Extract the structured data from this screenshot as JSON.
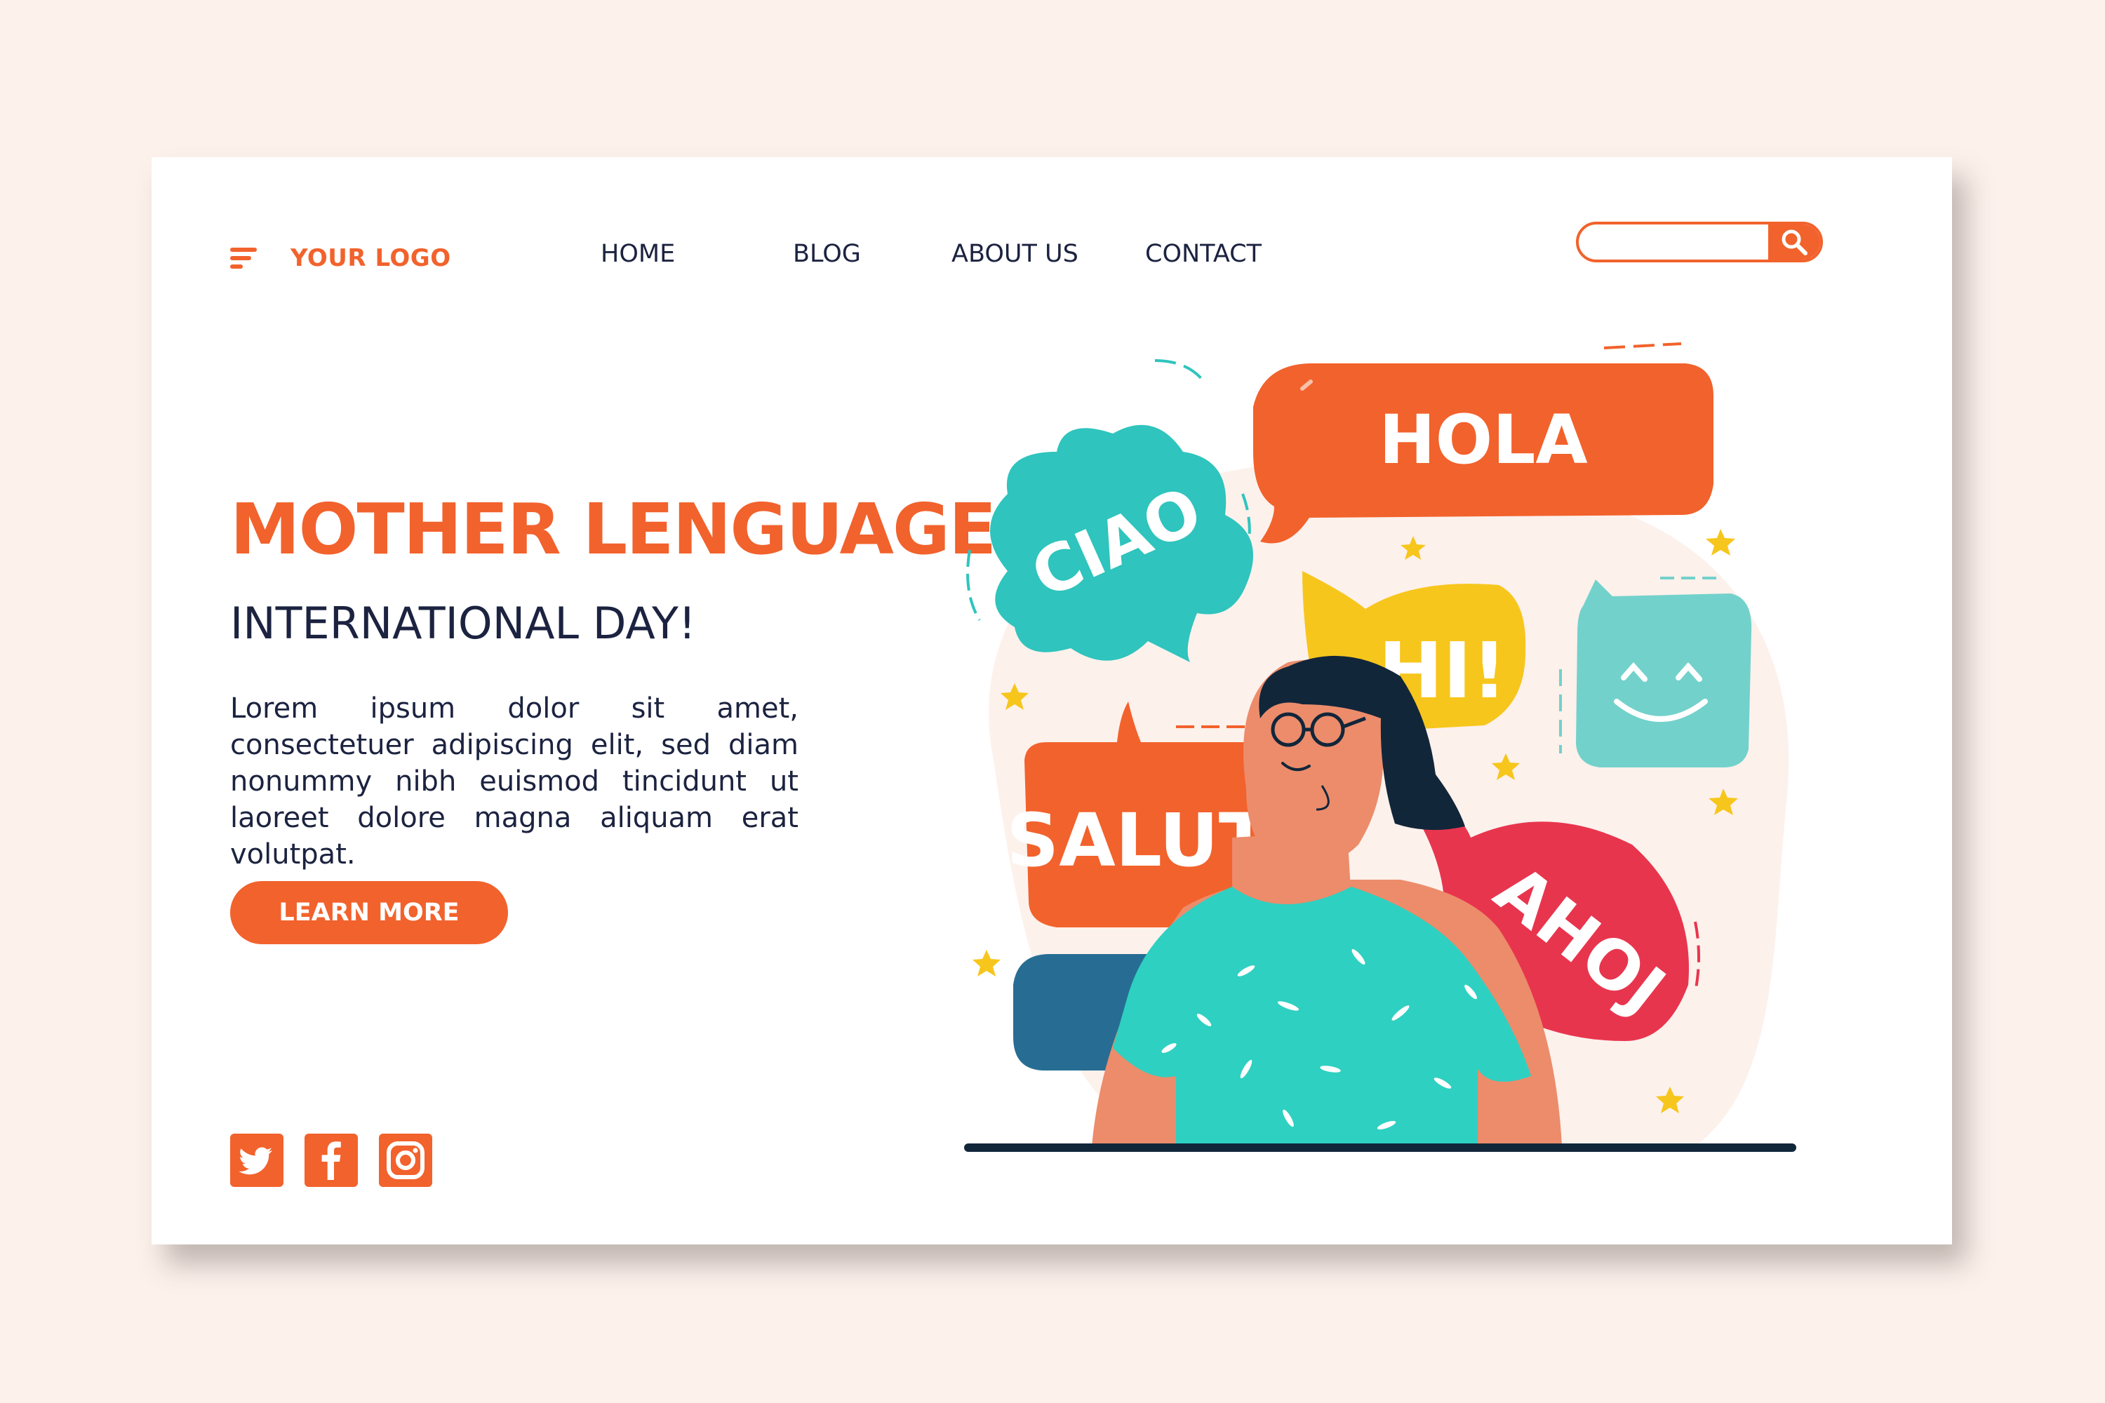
{
  "header": {
    "logo_text": "YOUR LOGO",
    "logo_icon": "hamburger-lines-icon",
    "nav": [
      {
        "label": "HOME"
      },
      {
        "label": "BLOG"
      },
      {
        "label": "ABOUT US"
      },
      {
        "label": "CONTACT"
      }
    ],
    "search": {
      "placeholder": "",
      "value": "",
      "icon": "search-icon"
    }
  },
  "hero": {
    "title": "MOTHER LENGUAGE",
    "subtitle": "INTERNATIONAL DAY!",
    "body": "Lorem ipsum dolor sit amet, consectetuer adipiscing elit, sed diam nonummy nibh euismod tincidunt ut laoreet dolore magna aliquam erat volutpat.",
    "cta_label": "LEARN MORE"
  },
  "illustration": {
    "bubbles": [
      {
        "word": "CIAO",
        "color": "#2fc4bd"
      },
      {
        "word": "HOLA",
        "color": "#f2622c"
      },
      {
        "word": "HI!",
        "color": "#f7c61c"
      },
      {
        "word": "SALUT",
        "color": "#f2622c"
      },
      {
        "word": "AHOJ",
        "color": "#e8354e"
      }
    ],
    "smiley_icon": "smiley-face-icon"
  },
  "social": [
    {
      "name": "twitter-icon"
    },
    {
      "name": "facebook-icon"
    },
    {
      "name": "instagram-icon"
    }
  ],
  "colors": {
    "accent": "#f2622c",
    "text": "#1c2340",
    "background": "#fdf1ec"
  }
}
